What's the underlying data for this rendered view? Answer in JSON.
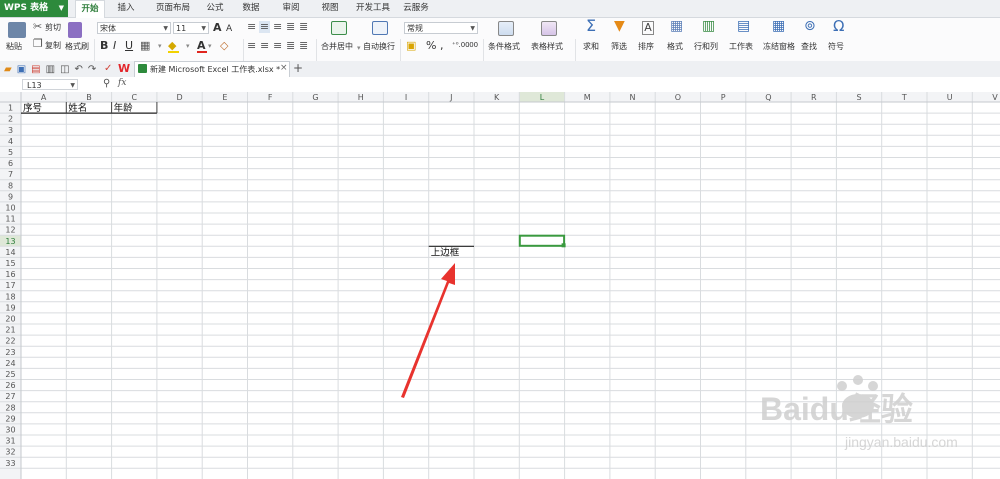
{
  "app": {
    "name": "WPS 表格"
  },
  "menu": {
    "tabs": [
      "开始",
      "插入",
      "页面布局",
      "公式",
      "数据",
      "审阅",
      "视图",
      "开发工具",
      "云服务"
    ],
    "active_index": 0
  },
  "ribbon": {
    "clipboard": {
      "paste": "粘贴",
      "cut": "剪切",
      "copy": "复制",
      "format_painter": "格式刷"
    },
    "font": {
      "name": "宋体",
      "size": "11"
    },
    "merge_center": "合并居中",
    "wrap_text": "自动换行",
    "number_format": "常规",
    "conditional_format": "条件格式",
    "table_style": "表格样式",
    "sum": "求和",
    "filter": "筛选",
    "sort": "排序",
    "format": "格式",
    "row_col": "行和列",
    "worksheet": "工作表",
    "freeze": "冻结窗格",
    "find": "查找",
    "symbol": "符号"
  },
  "document": {
    "tab_title": "新建 Microsoft Excel 工作表.xlsx *"
  },
  "formula_bar": {
    "cell_ref": "L13",
    "fx": "fx",
    "formula": ""
  },
  "sheet": {
    "columns": [
      "A",
      "B",
      "C",
      "D",
      "E",
      "F",
      "G",
      "H",
      "I",
      "J",
      "K",
      "L",
      "M",
      "N",
      "O",
      "P",
      "Q",
      "R",
      "S",
      "T",
      "U",
      "V"
    ],
    "row_count": 33,
    "active_col": "L",
    "active_row": 13,
    "cells": [
      {
        "ref": "A1",
        "value": "序号"
      },
      {
        "ref": "B1",
        "value": "姓名"
      },
      {
        "ref": "C1",
        "value": "年龄"
      },
      {
        "ref": "J14",
        "value": "上边框"
      }
    ]
  },
  "annotation": {
    "arrow_color": "#e8332e"
  },
  "watermark": {
    "brand": "Baidu经验",
    "url": "jingyan.baidu.com"
  },
  "colors": {
    "accent": "#2d8a3c",
    "selection": "#3a9a3f"
  }
}
